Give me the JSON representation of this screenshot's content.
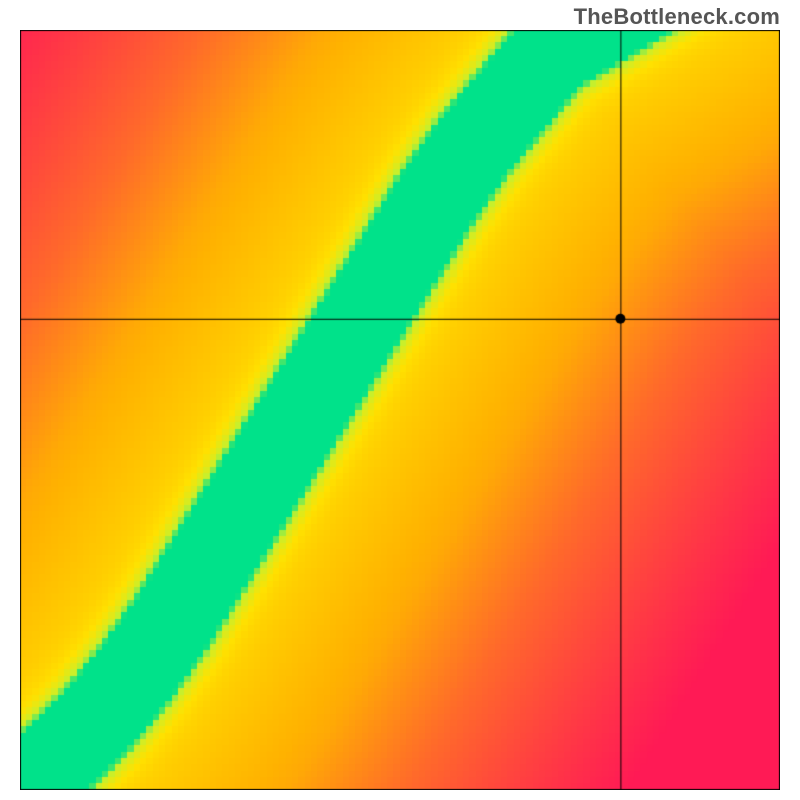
{
  "watermark": "TheBottleneck.com",
  "chart_data": {
    "type": "heatmap",
    "title": "",
    "xlabel": "",
    "ylabel": "",
    "xlim": [
      0,
      1
    ],
    "ylim": [
      0,
      1
    ],
    "grid": false,
    "legend": false,
    "description": "Square heatmap where color encodes closeness of (x,y) to an optimal ridge curve. Green = on ridge, yellow = near, orange/red = far. A diagonal green band curves from the lower-left corner upward toward the upper-middle region.",
    "ridge_points": [
      {
        "x": 0.0,
        "y": 0.0
      },
      {
        "x": 0.05,
        "y": 0.04
      },
      {
        "x": 0.1,
        "y": 0.09
      },
      {
        "x": 0.15,
        "y": 0.15
      },
      {
        "x": 0.2,
        "y": 0.22
      },
      {
        "x": 0.25,
        "y": 0.3
      },
      {
        "x": 0.3,
        "y": 0.38
      },
      {
        "x": 0.35,
        "y": 0.46
      },
      {
        "x": 0.4,
        "y": 0.54
      },
      {
        "x": 0.45,
        "y": 0.62
      },
      {
        "x": 0.5,
        "y": 0.7
      },
      {
        "x": 0.55,
        "y": 0.78
      },
      {
        "x": 0.6,
        "y": 0.85
      },
      {
        "x": 0.65,
        "y": 0.91
      },
      {
        "x": 0.7,
        "y": 0.97
      },
      {
        "x": 0.75,
        "y": 1.0
      }
    ],
    "band_half_width": 0.04,
    "marker": {
      "x": 0.79,
      "y": 0.62,
      "radius": 5
    },
    "crosshair": {
      "x": 0.79,
      "y": 0.62
    },
    "color_stops": [
      {
        "t": 0.0,
        "color": "#ff1a55"
      },
      {
        "t": 0.35,
        "color": "#ff6a2a"
      },
      {
        "t": 0.6,
        "color": "#ffb200"
      },
      {
        "t": 0.8,
        "color": "#ffe100"
      },
      {
        "t": 0.92,
        "color": "#c9ef2b"
      },
      {
        "t": 1.0,
        "color": "#00e28a"
      }
    ],
    "pixelation": 120
  }
}
